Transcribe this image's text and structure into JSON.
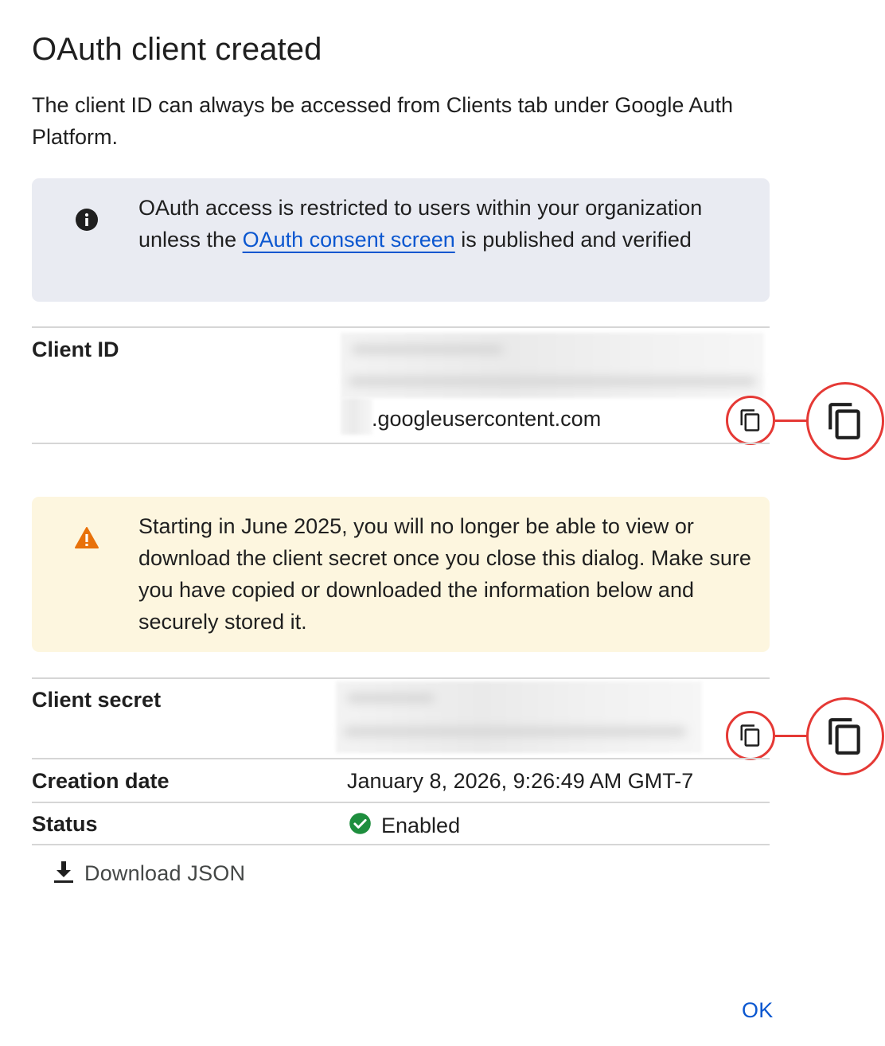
{
  "dialog": {
    "title": "OAuth client created",
    "intro": "The client ID can always be accessed from Clients tab under Google Auth Platform."
  },
  "info_banner": {
    "icon": "info-icon",
    "text_before": "OAuth access is restricted to users within your organization unless the ",
    "link": "OAuth consent screen",
    "text_after": " is published and verified"
  },
  "client_id": {
    "label": "Client ID",
    "visible_suffix": ".googleusercontent.com",
    "copy_icon": "copy-icon"
  },
  "warning_banner": {
    "icon": "warning-icon",
    "text": "Starting in June 2025, you will no longer be able to view or download the client secret once you close this dialog. Make sure you have copied or downloaded the information below and securely stored it."
  },
  "client_secret": {
    "label": "Client secret",
    "copy_icon": "copy-icon"
  },
  "creation_date": {
    "label": "Creation date",
    "value": "January 8, 2026, 9:26:49 AM GMT-7"
  },
  "status": {
    "label": "Status",
    "value": "Enabled",
    "icon": "check-circle-icon"
  },
  "download": {
    "label": "Download JSON",
    "icon": "download-icon"
  },
  "ok_button": "OK",
  "colors": {
    "accent": "#0b57d0",
    "highlight": "#e53935",
    "info_bg": "#e9ebf2",
    "warn_bg": "#fdf6df",
    "warn_icon": "#e8710a",
    "success": "#1e8e3e"
  }
}
